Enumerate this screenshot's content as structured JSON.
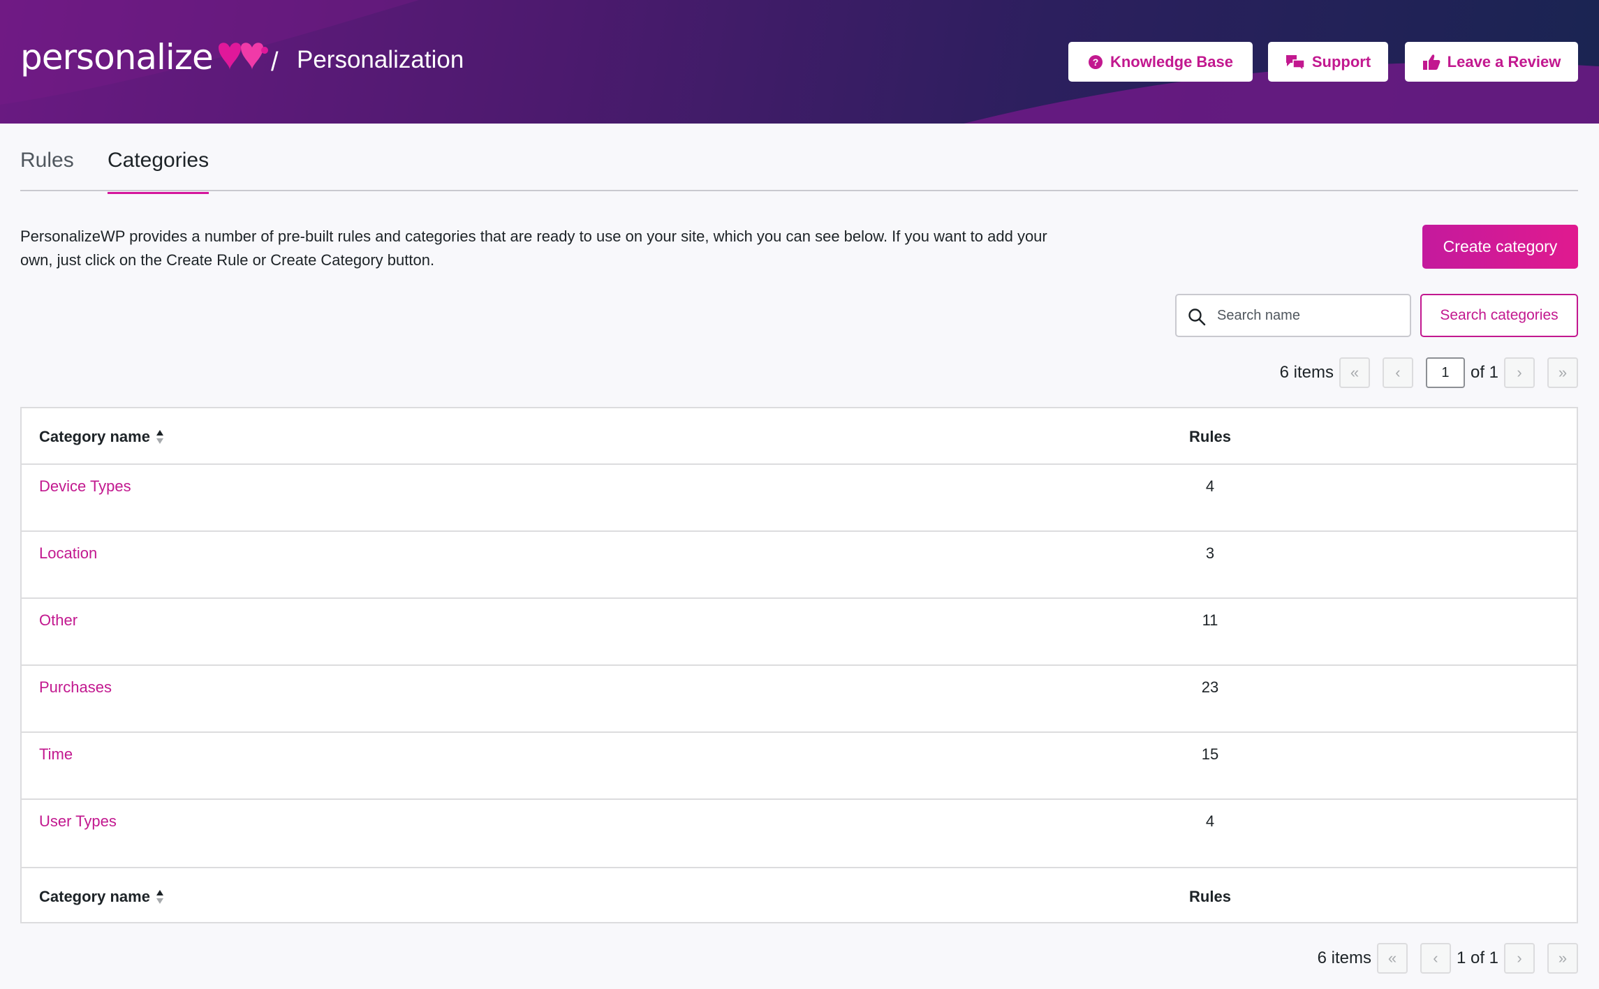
{
  "header": {
    "logo_text": "personalize",
    "separator": "/",
    "title": "Personalization",
    "buttons": [
      {
        "label": "Knowledge Base",
        "icon": "question-circle-icon"
      },
      {
        "label": "Support",
        "icon": "chat-bubbles-icon"
      },
      {
        "label": "Leave a Review",
        "icon": "thumbs-up-icon"
      }
    ]
  },
  "tabs": [
    {
      "label": "Rules",
      "active": false
    },
    {
      "label": "Categories",
      "active": true
    }
  ],
  "description": "PersonalizeWP provides a number of pre-built rules and categories that are ready to use on your site, which you can see below. If you want to add your own, just click on the Create Rule or Create Category button.",
  "create_button": "Create category",
  "search": {
    "placeholder": "Search name",
    "button": "Search categories"
  },
  "pagination_top": {
    "count": "6 items",
    "first": "«",
    "prev": "‹",
    "page": "1",
    "of": "of 1",
    "next": "›",
    "last": "»"
  },
  "pagination_bottom": {
    "count": "6 items",
    "first": "«",
    "prev": "‹",
    "page_text": "1 of 1",
    "next": "›",
    "last": "»"
  },
  "table": {
    "columns": [
      "Category name",
      "Rules"
    ],
    "rows": [
      {
        "name": "Device Types",
        "rules": "4"
      },
      {
        "name": "Location",
        "rules": "3"
      },
      {
        "name": "Other",
        "rules": "11"
      },
      {
        "name": "Purchases",
        "rules": "23"
      },
      {
        "name": "Time",
        "rules": "15"
      },
      {
        "name": "User Types",
        "rules": "4"
      }
    ]
  },
  "colors": {
    "accent": "#c2188f",
    "header_dark": "#2c1f5e",
    "header_purple": "#6a1a82"
  }
}
